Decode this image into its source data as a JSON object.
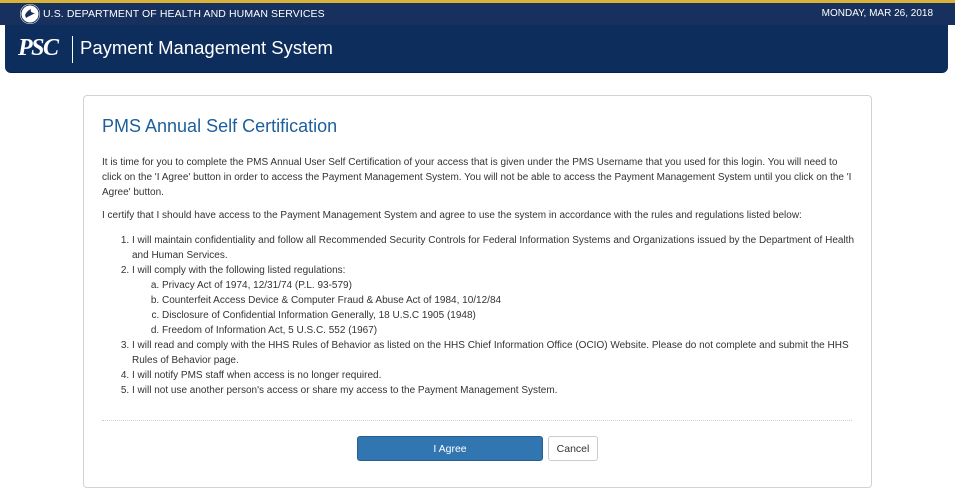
{
  "top_bar": {
    "agency": "U.S. DEPARTMENT OF HEALTH AND HUMAN SERVICES",
    "date": "MONDAY, MAR 26, 2018"
  },
  "header": {
    "logo": "PSC",
    "title": "Payment Management System"
  },
  "certification": {
    "title": "PMS Annual Self Certification",
    "intro": "It is time for you to complete the PMS Annual User Self Certification of your access that is given under the PMS Username that you used for this login. You will need to click on the 'I Agree' button in order to access the Payment Management System. You will not be able to access the Payment Management System until you click on the 'I Agree' button.",
    "certify": "I certify that I should have access to the Payment Management System and agree to use the system in accordance with the rules and regulations listed below:",
    "rules": [
      "I will maintain confidentiality and follow all Recommended Security Controls for Federal Information Systems and Organizations issued by the Department of Health and Human Services.",
      "I will comply with the following listed regulations:",
      "I will read and comply with the HHS Rules of Behavior as listed on the HHS Chief Information Office (OCIO) Website. Please do not complete and submit the HHS Rules of Behavior page.",
      "I will notify PMS staff when access is no longer required.",
      "I will not use another person's access or share my access to the Payment Management System."
    ],
    "regulations": [
      "Privacy Act of 1974, 12/31/74 (P.L. 93-579)",
      "Counterfeit Access Device & Computer Fraud & Abuse Act of 1984, 10/12/84",
      "Disclosure of Confidential Information Generally, 18 U.S.C 1905 (1948)",
      "Freedom of Information Act, 5 U.S.C. 552 (1967)"
    ],
    "agree_label": "I Agree",
    "cancel_label": "Cancel"
  },
  "colors": {
    "top_bar": "#17305e",
    "header": "#0d2e5c",
    "gold_accent": "#d9b23a",
    "title_blue": "#1c5f9c",
    "primary_button": "#3276b1"
  },
  "icons": {
    "hhs_logo": "hhs-eagle-icon"
  }
}
